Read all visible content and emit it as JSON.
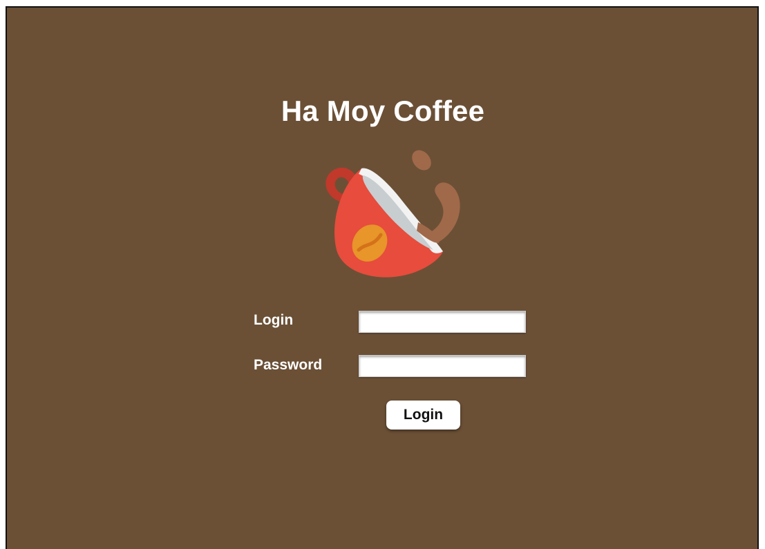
{
  "app": {
    "title": "Ha Moy Coffee",
    "logo_icon": "coffee-cup-icon"
  },
  "form": {
    "login_label": "Login",
    "login_value": "",
    "password_label": "Password",
    "password_value": "",
    "submit_label": "Login"
  },
  "colors": {
    "background": "#6b5036",
    "cup": "#e74c3c",
    "coffee": "#a0694a",
    "bean": "#e8952a",
    "text": "#ffffff"
  }
}
